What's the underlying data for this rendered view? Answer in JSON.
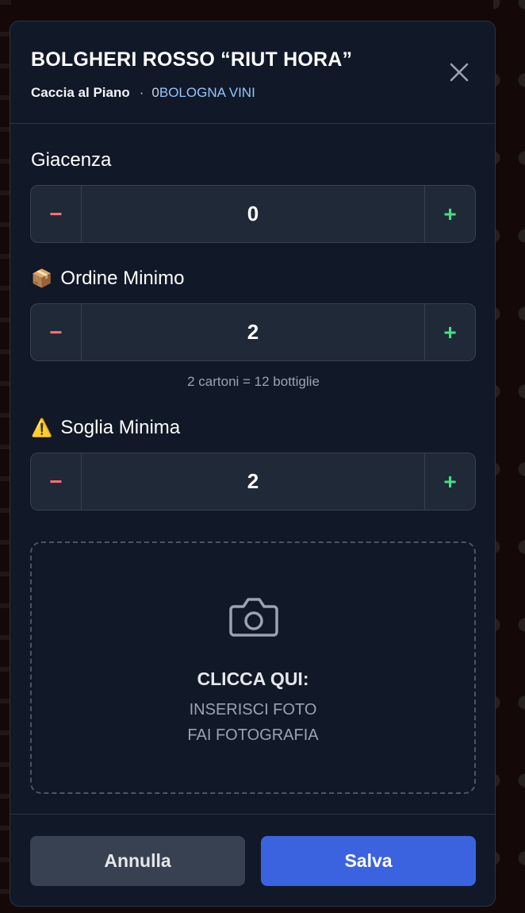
{
  "product": {
    "title": "BOLGHERI ROSSO “RIUT HORA”",
    "venue": "Caccia al Piano",
    "separator": "·",
    "count": "0",
    "supplier": "BOLOGNA VINI"
  },
  "giacenza": {
    "label": "Giacenza",
    "value": "0",
    "minus": "−",
    "plus": "+"
  },
  "ordine_minimo": {
    "icon": "📦",
    "label": "Ordine Minimo",
    "value": "2",
    "minus": "−",
    "plus": "+",
    "hint": "2 cartoni = 12 bottiglie"
  },
  "soglia_minima": {
    "icon": "⚠️",
    "label": "Soglia Minima",
    "value": "2",
    "minus": "−",
    "plus": "+"
  },
  "photo": {
    "title": "CLICCA QUI:",
    "line1": "INSERISCI FOTO",
    "line2": "FAI FOTOGRAFIA"
  },
  "footer": {
    "cancel_label": "Annulla",
    "save_label": "Salva"
  },
  "colors": {
    "accent": "#3b63e0",
    "minus": "#f87171",
    "plus": "#4ade80",
    "supplier": "#93c5fd"
  }
}
